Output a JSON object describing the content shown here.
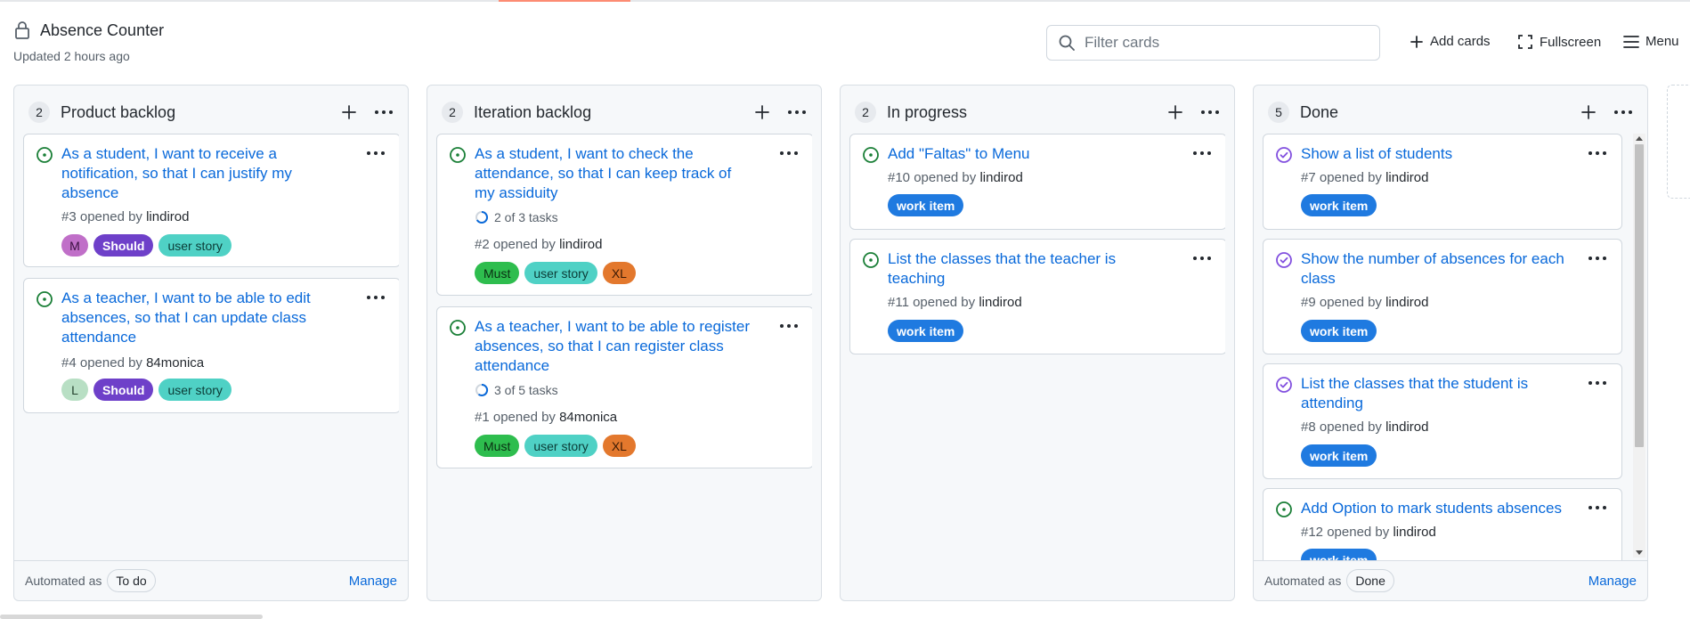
{
  "project": {
    "title": "Absence Counter",
    "updated": "Updated 2 hours ago"
  },
  "toolbar": {
    "filter_placeholder": "Filter cards",
    "add_cards": "Add cards",
    "fullscreen": "Fullscreen",
    "menu": "Menu"
  },
  "columns": [
    {
      "count": "2",
      "name": "Product backlog",
      "automated_label": "Automated as",
      "automated_value": "To do",
      "manage": "Manage",
      "cards": [
        {
          "title": "As a student, I want to receive a notification, so that I can justify my absence",
          "number": "#3 opened by",
          "author": "lindirod",
          "avatar": "M",
          "labels": [
            "Should",
            "user story"
          ]
        },
        {
          "title": "As a teacher, I want to be able to edit absences, so that I can update class attendance",
          "number": "#4 opened by",
          "author": "84monica",
          "avatar": "L",
          "labels": [
            "Should",
            "user story"
          ]
        }
      ]
    },
    {
      "count": "2",
      "name": "Iteration backlog",
      "cards": [
        {
          "title": "As a student, I want to check the attendance, so that I can keep track of my assiduity",
          "tasks": "2 of 3 tasks",
          "number": "#2 opened by",
          "author": "lindirod",
          "labels": [
            "Must",
            "user story",
            "XL"
          ]
        },
        {
          "title": "As a teacher, I want to be able to register absences, so that I can register class attendance",
          "tasks": "3 of 5 tasks",
          "number": "#1 opened by",
          "author": "84monica",
          "labels": [
            "Must",
            "user story",
            "XL"
          ]
        }
      ]
    },
    {
      "count": "2",
      "name": "In progress",
      "cards": [
        {
          "title": "Add \"Faltas\" to Menu",
          "number": "#10 opened by",
          "author": "lindirod",
          "labels": [
            "work item"
          ]
        },
        {
          "title": "List the classes that the teacher is teaching",
          "number": "#11 opened by",
          "author": "lindirod",
          "labels": [
            "work item"
          ]
        }
      ]
    },
    {
      "count": "5",
      "name": "Done",
      "automated_label": "Automated as",
      "automated_value": "Done",
      "manage": "Manage",
      "cards": [
        {
          "title": "Show a list of students",
          "number": "#7 opened by",
          "author": "lindirod",
          "labels": [
            "work item"
          ]
        },
        {
          "title": "Show the number of absences for each class",
          "number": "#9 opened by",
          "author": "lindirod",
          "labels": [
            "work item"
          ]
        },
        {
          "title": "List the classes that the student is attending",
          "number": "#8 opened by",
          "author": "lindirod",
          "labels": [
            "work item"
          ]
        },
        {
          "title": "Add Option to mark students absences",
          "number": "#12 opened by",
          "author": "lindirod",
          "labels": [
            "work item"
          ]
        }
      ]
    }
  ],
  "colors": {
    "link": "#0969da",
    "open_issue": "#1a7f37",
    "closed_issue": "#8250df",
    "should": "#6e40c9",
    "user_story": "#4fd1c5",
    "must": "#2ebd4e",
    "xl": "#e3782d",
    "work_item": "#1f7ae0",
    "avatar_m": "#c06fc8",
    "avatar_l": "#b8dfc4"
  },
  "icons": {
    "lock": "lock-icon",
    "search": "search-icon",
    "plus": "plus-icon",
    "fullscreen": "fullscreen-icon",
    "menu": "hamburger-icon",
    "kebab": "kebab-horizontal-icon",
    "issue_open": "issue-open-icon",
    "issue_closed": "issue-closed-icon",
    "progress": "progress-ring-icon"
  }
}
